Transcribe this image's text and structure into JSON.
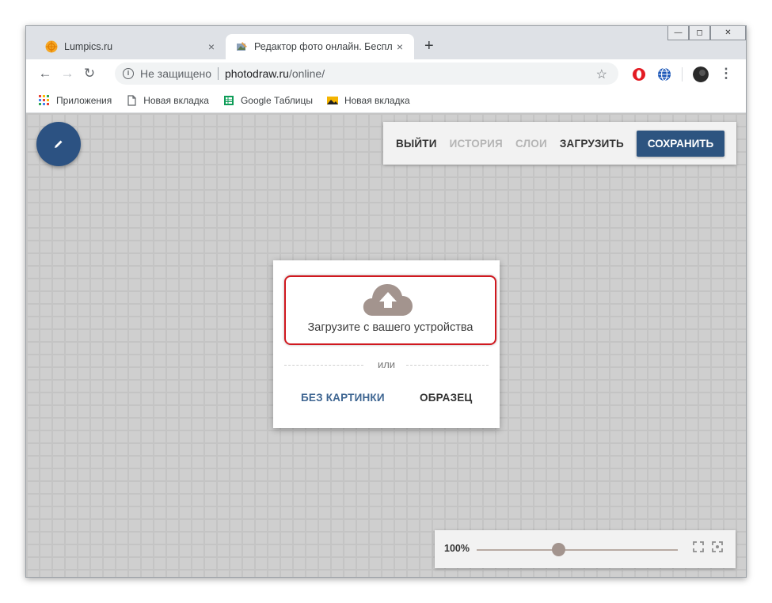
{
  "browser": {
    "tabs": [
      {
        "title": "Lumpics.ru",
        "close": "×"
      },
      {
        "title": "Редактор фото онлайн. Бесплат",
        "close": "×"
      }
    ],
    "new_tab": "+",
    "address": {
      "security": "Не защищено",
      "host": "photodraw.ru",
      "path": "/online/"
    },
    "bookmarks": [
      {
        "label": "Приложения",
        "icon": "apps-grid-icon"
      },
      {
        "label": "Новая вкладка",
        "icon": "page-icon"
      },
      {
        "label": "Google Таблицы",
        "icon": "sheets-icon"
      },
      {
        "label": "Новая вкладка",
        "icon": "image-icon"
      }
    ]
  },
  "editor": {
    "menu": {
      "exit": "ВЫЙТИ",
      "history": "ИСТОРИЯ",
      "layers": "СЛОИ",
      "upload": "ЗАГРУЗИТЬ",
      "save": "СОХРАНИТЬ"
    },
    "dialog": {
      "upload_text": "Загрузите с вашего устройства",
      "or": "или",
      "no_picture": "БЕЗ КАРТИНКИ",
      "sample": "ОБРАЗЕЦ"
    },
    "zoom": {
      "label": "100%",
      "slider_fraction": 0.4
    }
  },
  "colors": {
    "accent": "#2d5480",
    "highlight": "#d0181f"
  }
}
